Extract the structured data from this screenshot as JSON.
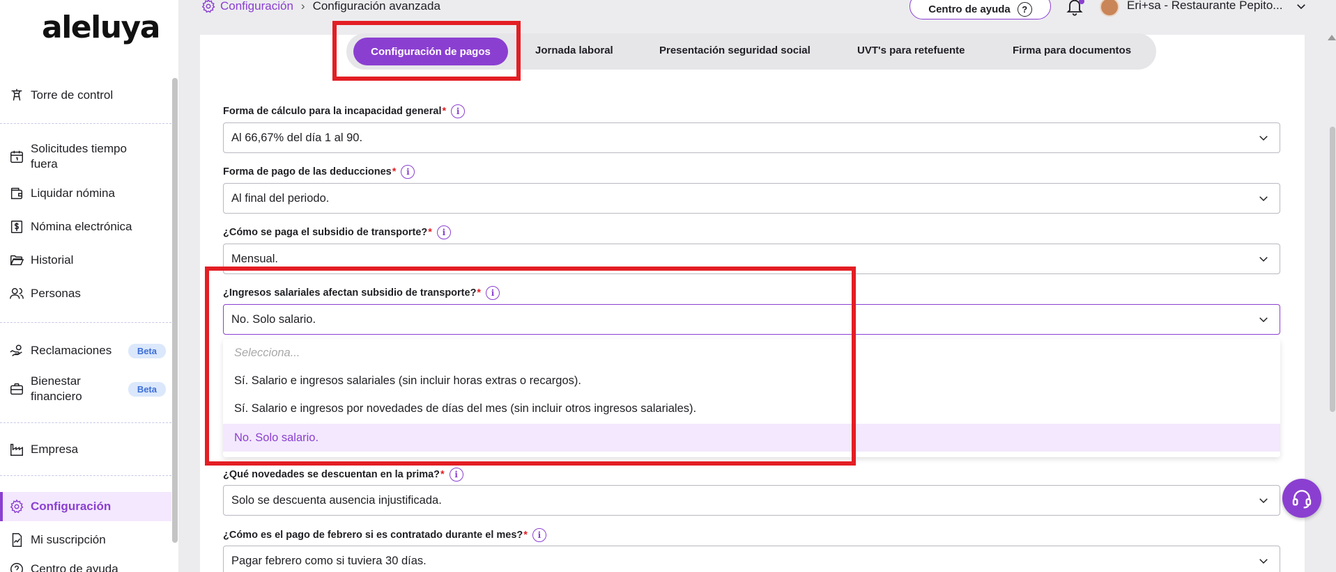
{
  "app": {
    "logo_text": "aleluya",
    "brand_color": "#8b3fd1",
    "highlight_color": "#e31e24"
  },
  "breadcrumb": {
    "parent": "Configuración",
    "separator": "›",
    "current": "Configuración avanzada"
  },
  "header": {
    "help_label": "Centro de ayuda",
    "help_icon_glyph": "?",
    "user_name": "Eri+sa - Restaurante Pepito..."
  },
  "sidebar": {
    "items": [
      {
        "label": "Torre de control",
        "icon": "control-tower-icon"
      },
      {
        "label": "Solicitudes tiempo fuera",
        "icon": "calendar-icon"
      },
      {
        "label": "Liquidar nómina",
        "icon": "wallet-icon"
      },
      {
        "label": "Nómina electrónica",
        "icon": "dollar-document-icon"
      },
      {
        "label": "Historial",
        "icon": "folder-icon"
      },
      {
        "label": "Personas",
        "icon": "people-icon"
      },
      {
        "label": "Reclamaciones",
        "icon": "hand-coin-icon",
        "badge": "Beta"
      },
      {
        "label": "Bienestar financiero",
        "icon": "briefcase-icon",
        "badge": "Beta"
      },
      {
        "label": "Empresa",
        "icon": "factory-icon"
      },
      {
        "label": "Configuración",
        "icon": "gear-icon",
        "active": true
      },
      {
        "label": "Mi suscripción",
        "icon": "subscription-icon"
      },
      {
        "label": "Centro de ayuda",
        "icon": "help-icon"
      }
    ]
  },
  "tabs": [
    {
      "label": "Configuración de pagos",
      "active": true
    },
    {
      "label": "Jornada laboral"
    },
    {
      "label": "Presentación seguridad social"
    },
    {
      "label": "UVT's para retefuente"
    },
    {
      "label": "Firma para documentos"
    }
  ],
  "fields": [
    {
      "label": "Forma de cálculo para la incapacidad general",
      "required_mark": "*",
      "value": "Al 66,67% del día 1 al 90."
    },
    {
      "label": "Forma de pago de las deducciones",
      "required_mark": "*",
      "value": "Al final del periodo."
    },
    {
      "label": "¿Cómo se paga el subsidio de transporte?",
      "required_mark": "*",
      "value": "Mensual."
    },
    {
      "label": "¿Ingresos salariales afectan subsidio de transporte?",
      "required_mark": "*",
      "value": "No. Solo salario."
    },
    {
      "label": "¿Qué novedades se descuentan en la prima?",
      "required_mark": "*",
      "value": "Solo se descuenta ausencia injustificada."
    },
    {
      "label": "¿Cómo es el pago de febrero si es contratado durante el mes?",
      "required_mark": "*",
      "value": "Pagar febrero como si tuviera 30 días."
    }
  ],
  "dropdown": {
    "placeholder": "Selecciona...",
    "options": [
      "Sí. Salario e ingresos salariales (sin incluir horas extras o recargos).",
      "Sí. Salario e ingresos por novedades de días del mes (sin incluir otros ingresos salariales).",
      "No. Solo salario."
    ],
    "selected_index": 2
  }
}
